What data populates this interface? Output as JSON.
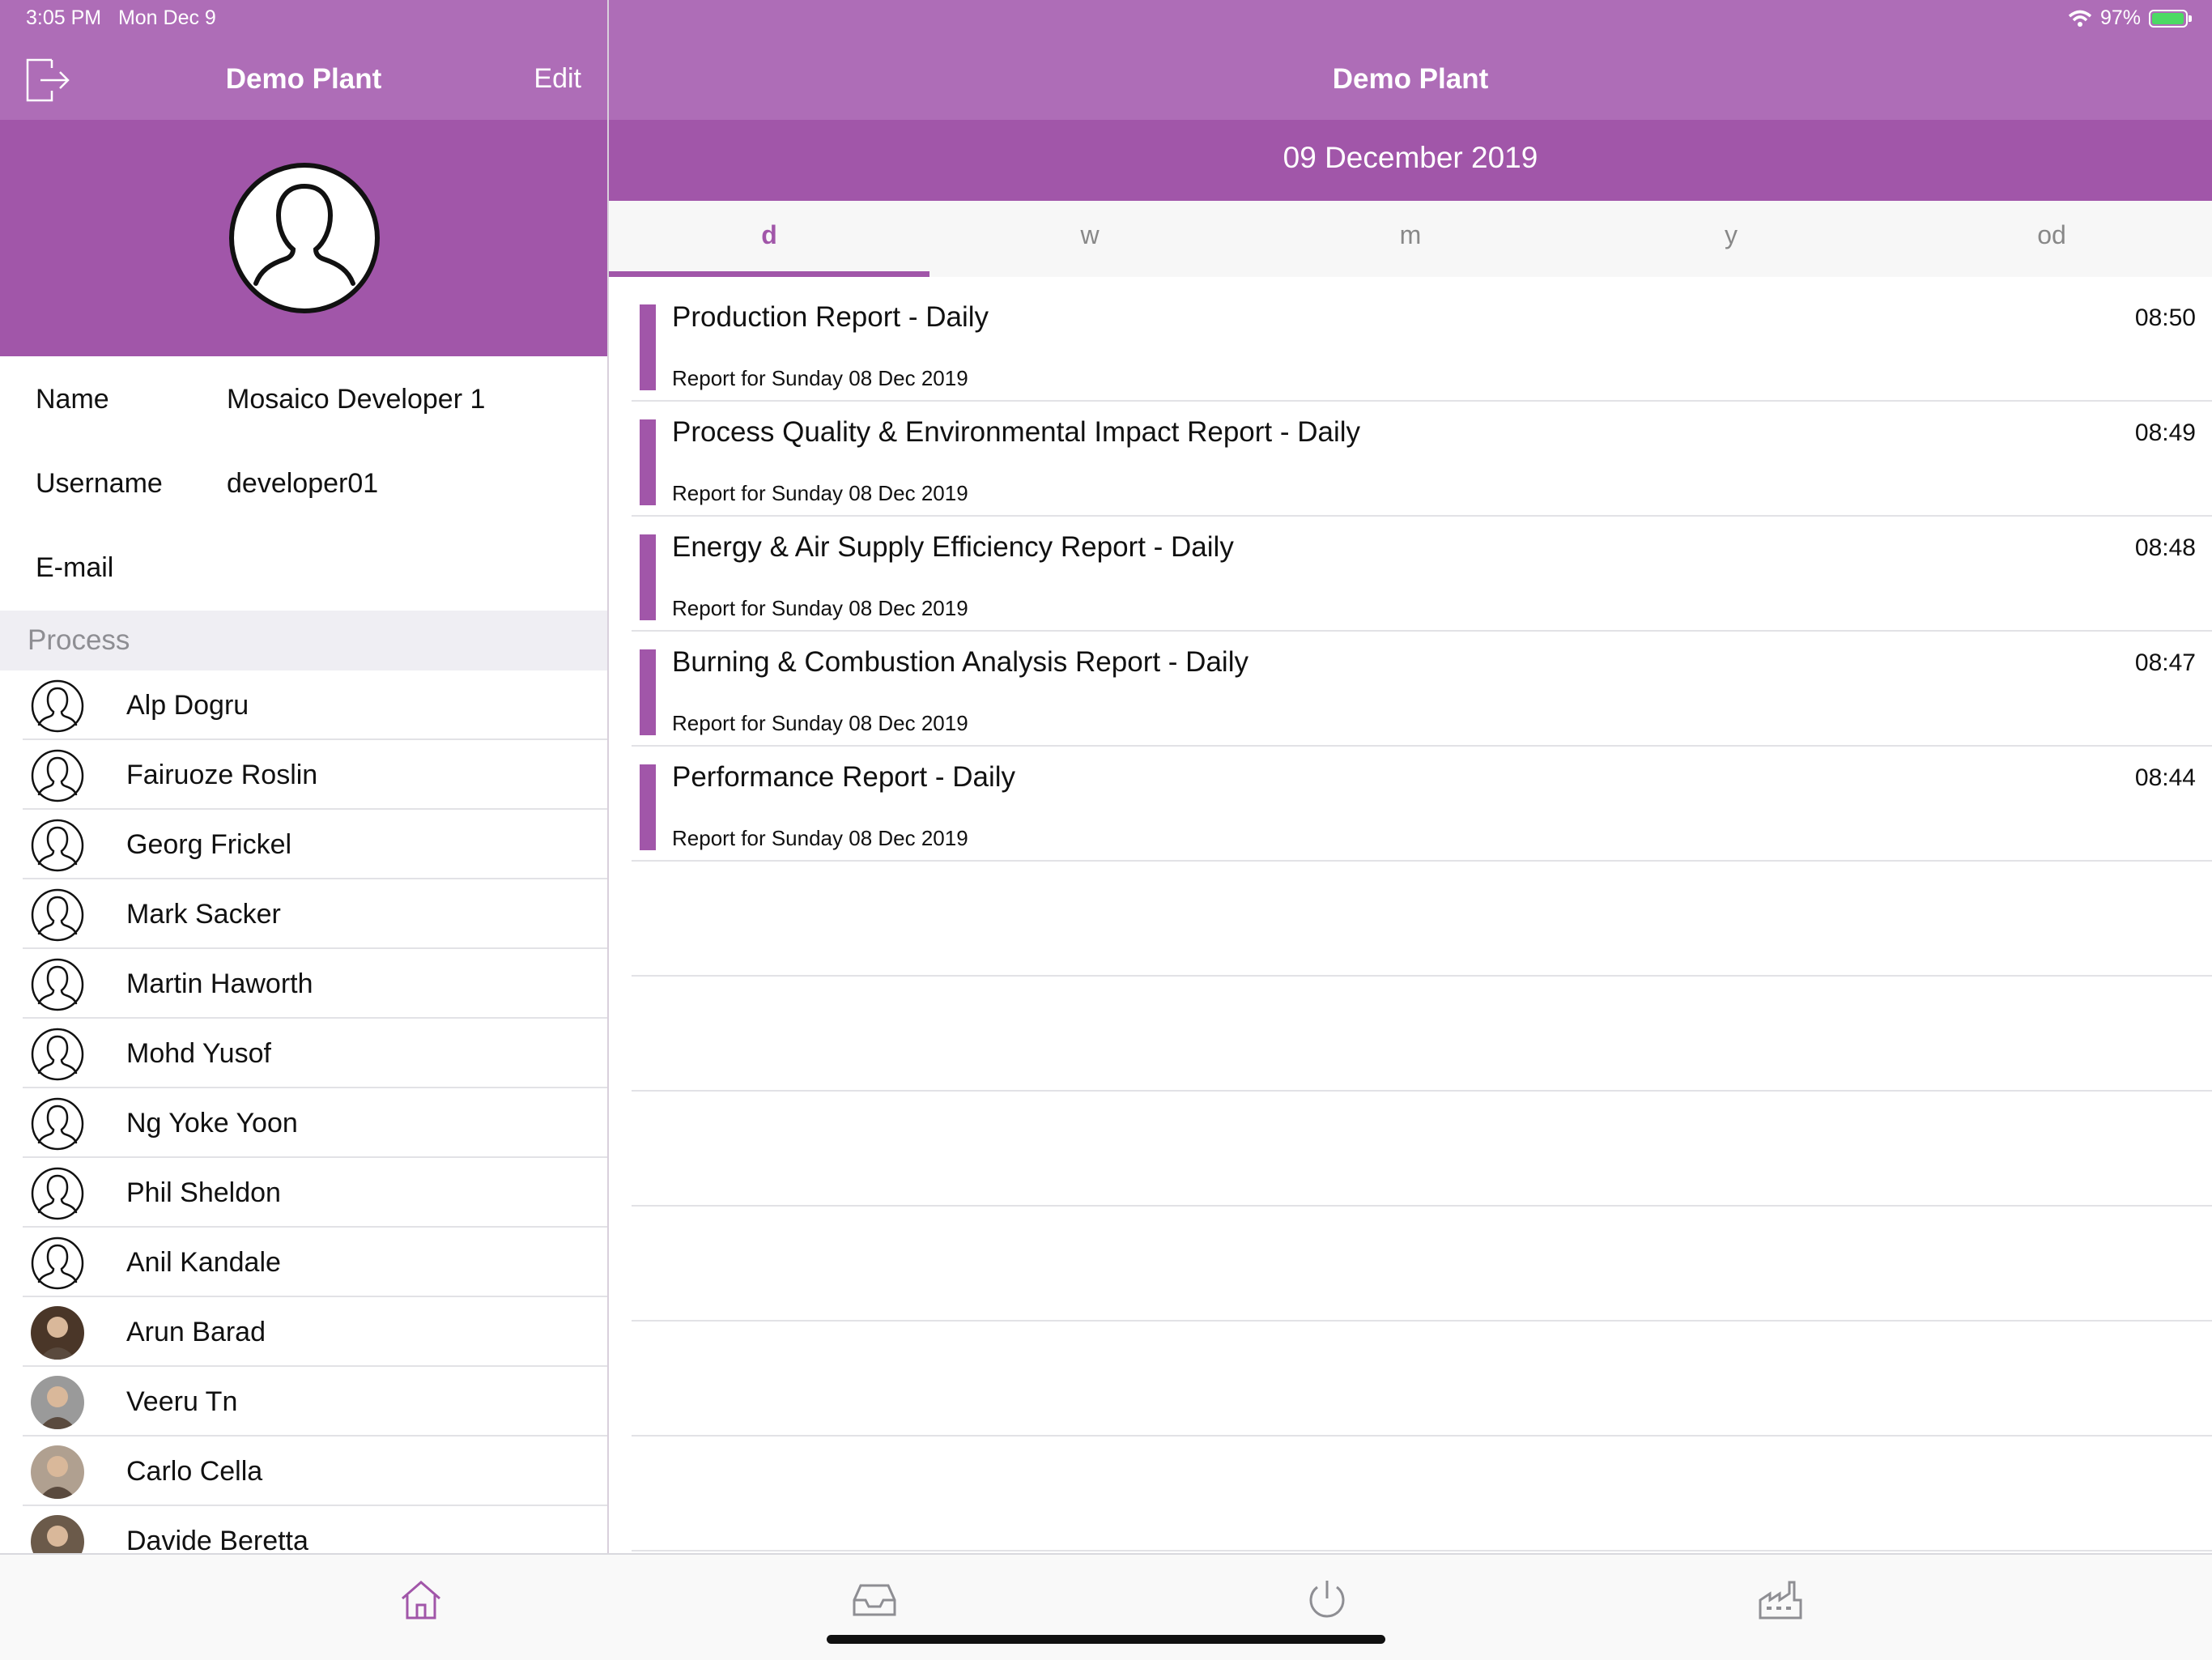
{
  "status_bar": {
    "time": "3:05 PM",
    "date": "Mon Dec 9",
    "battery": "97%",
    "battery_level": 0.97
  },
  "left_header": {
    "title": "Demo Plant",
    "edit_label": "Edit",
    "logout_icon": "logout-icon"
  },
  "right_header": {
    "title": "Demo Plant"
  },
  "profile": {
    "avatar_icon": "user-silhouette-icon",
    "fields": [
      {
        "label": "Name",
        "value": "Mosaico Developer 1"
      },
      {
        "label": "Username",
        "value": "developer01"
      },
      {
        "label": "E-mail",
        "value": ""
      }
    ]
  },
  "section": {
    "title": "Process"
  },
  "people": [
    {
      "name": "Alp Dogru",
      "avatar": "user-outline-icon"
    },
    {
      "name": "Fairuoze Roslin",
      "avatar": "user-outline-icon"
    },
    {
      "name": "Georg Frickel",
      "avatar": "user-outline-icon"
    },
    {
      "name": "Mark Sacker",
      "avatar": "user-outline-icon"
    },
    {
      "name": "Martin Haworth",
      "avatar": "user-outline-icon"
    },
    {
      "name": "Mohd Yusof",
      "avatar": "user-outline-icon"
    },
    {
      "name": "Ng Yoke Yoon",
      "avatar": "user-outline-icon"
    },
    {
      "name": "Phil Sheldon",
      "avatar": "user-outline-icon"
    },
    {
      "name": "Anil Kandale",
      "avatar": "user-outline-icon"
    },
    {
      "name": "Arun Barad",
      "avatar": "photo"
    },
    {
      "name": "Veeru Tn",
      "avatar": "photo"
    },
    {
      "name": "Carlo Cella",
      "avatar": "photo"
    },
    {
      "name": "Davide Beretta",
      "avatar": "photo"
    }
  ],
  "date_band": {
    "date": "09 December 2019"
  },
  "period_tabs": [
    {
      "label": "d",
      "active": true
    },
    {
      "label": "w",
      "active": false
    },
    {
      "label": "m",
      "active": false
    },
    {
      "label": "y",
      "active": false
    },
    {
      "label": "od",
      "active": false
    }
  ],
  "reports": [
    {
      "title": "Production Report - Daily",
      "subtitle": "Report for Sunday 08 Dec 2019",
      "time": "08:50"
    },
    {
      "title": "Process Quality & Environmental Impact Report - Daily",
      "subtitle": "Report for Sunday 08 Dec 2019",
      "time": "08:49"
    },
    {
      "title": "Energy & Air Supply Efficiency Report - Daily",
      "subtitle": "Report for Sunday 08 Dec 2019",
      "time": "08:48"
    },
    {
      "title": "Burning & Combustion Analysis Report - Daily",
      "subtitle": "Report for Sunday 08 Dec 2019",
      "time": "08:47"
    },
    {
      "title": "Performance Report - Daily",
      "subtitle": "Report for Sunday 08 Dec 2019",
      "time": "08:44"
    }
  ],
  "tab_bar": [
    {
      "icon": "home-icon",
      "active": true
    },
    {
      "icon": "inbox-icon",
      "active": false
    },
    {
      "icon": "power-icon",
      "active": false
    },
    {
      "icon": "factory-icon",
      "active": false
    }
  ],
  "colors": {
    "header": "#ae6db7",
    "accent": "#a156a9",
    "inactive": "#8e8e93"
  }
}
